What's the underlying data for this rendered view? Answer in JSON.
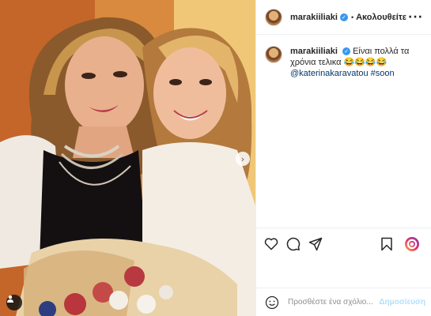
{
  "post": {
    "username": "marakiiliaki",
    "follow_separator": "•",
    "follow_label": "Ακολουθείτε",
    "more_icon": "more-dots-icon"
  },
  "caption": {
    "username": "marakiiliaki",
    "text": "Είναι πολλά τα χρόνια τελικα",
    "emojis": "😂😂😂😂",
    "mention": "@katerinakaravatou",
    "hashtag": "#soon"
  },
  "actions": {
    "like_icon": "heart-icon",
    "comment_icon": "comment-icon",
    "share_icon": "share-icon",
    "save_icon": "bookmark-icon",
    "sticker_icon": "instagram-sticker-icon"
  },
  "comment_box": {
    "placeholder": "Προσθέστε ένα σχόλιο...",
    "post_label": "Δημοσίευση"
  },
  "colors": {
    "verified": "#3897f0",
    "link": "#00376b",
    "post_disabled": "#b2dffc"
  }
}
